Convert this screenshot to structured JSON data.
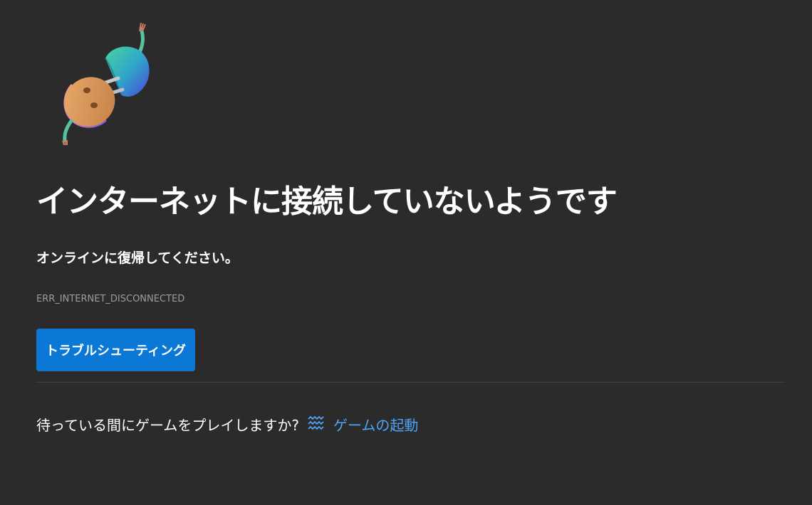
{
  "page": {
    "background": "#2b2b2b",
    "title": "インターネットに接続していないようです",
    "subtitle": "オンラインに復帰してください。",
    "error_code": "ERR_INTERNET_DISCONNECTED",
    "illustration_icon": "unplugged-cable-icon"
  },
  "actions": {
    "troubleshoot_label": "トラブルシューティング",
    "button_color": "#0a78d4"
  },
  "game": {
    "prompt": "待っている間にゲームをプレイしますか?",
    "link_label": "ゲームの起動",
    "icon": "surf-icon",
    "link_color": "#4fa3f7"
  }
}
